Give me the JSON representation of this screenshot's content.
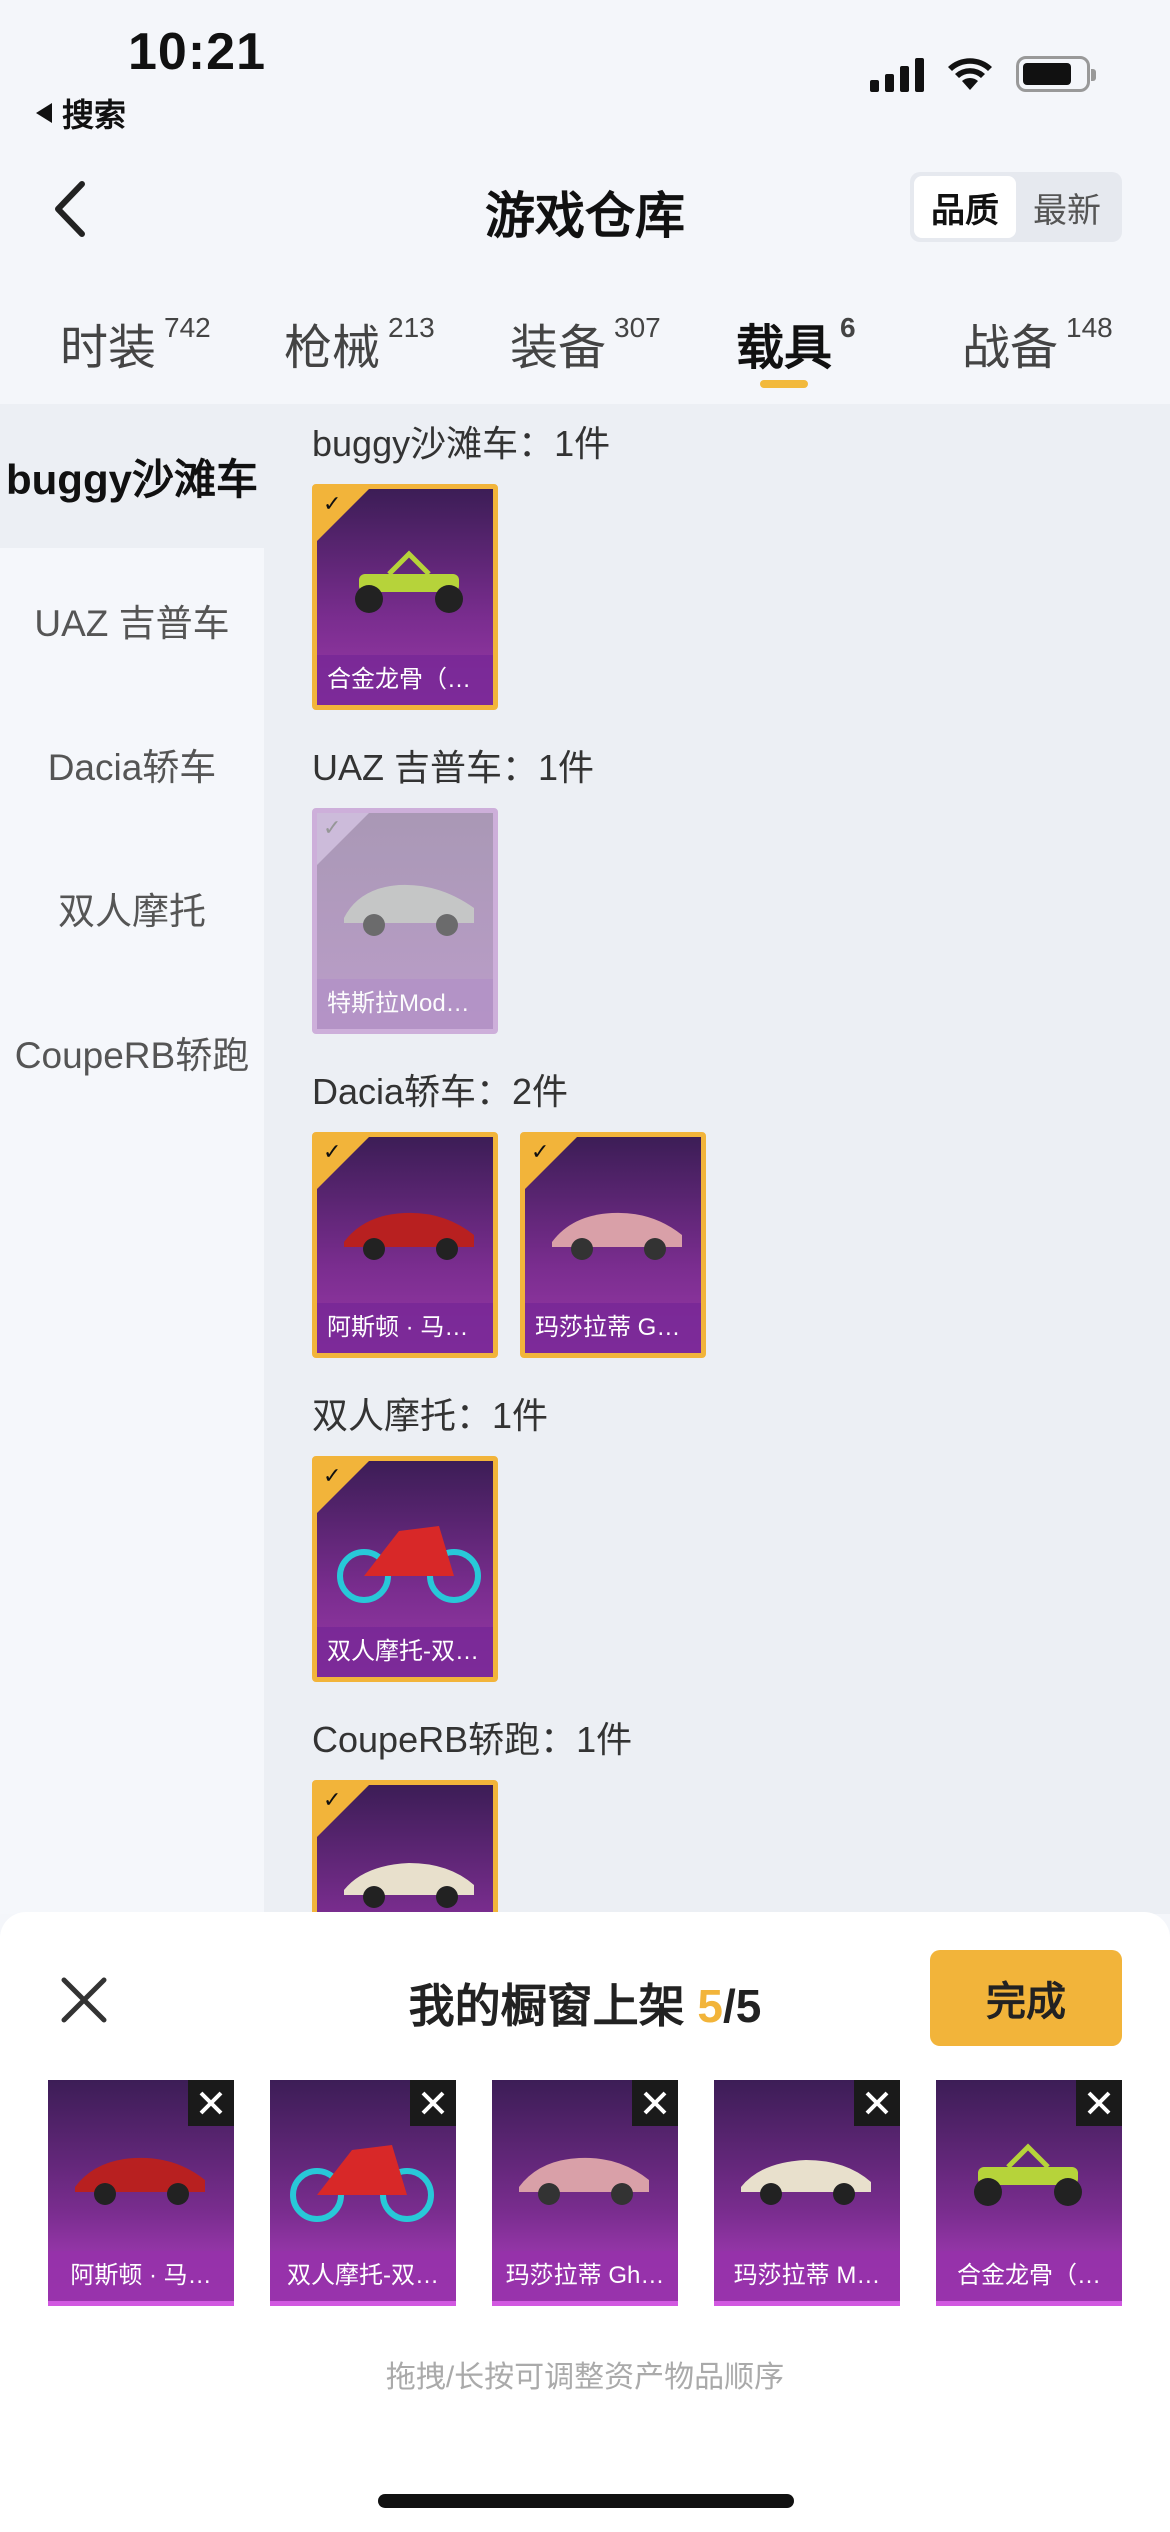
{
  "status_bar": {
    "time": "10:21",
    "back_app": "搜索"
  },
  "header": {
    "title": "游戏仓库",
    "sort_options": [
      "品质",
      "最新"
    ],
    "active_sort": "品质"
  },
  "tabs": [
    {
      "label": "时装",
      "count": "742"
    },
    {
      "label": "枪械",
      "count": "213"
    },
    {
      "label": "装备",
      "count": "307"
    },
    {
      "label": "载具",
      "count": "6"
    },
    {
      "label": "战备",
      "count": "148"
    }
  ],
  "active_tab": "载具",
  "sidebar": {
    "items": [
      {
        "label": "buggy沙滩车"
      },
      {
        "label": "UAZ 吉普车"
      },
      {
        "label": "Dacia轿车"
      },
      {
        "label": "双人摩托"
      },
      {
        "label": "CoupeRB轿跑"
      }
    ]
  },
  "groups": [
    {
      "title": "buggy沙滩车：1件",
      "items": [
        {
          "name": "合金龙骨（…",
          "selected": true,
          "color": "#b6d33a"
        }
      ]
    },
    {
      "title": "UAZ 吉普车：1件",
      "items": [
        {
          "name": "特斯拉Mod…",
          "selected": false,
          "color": "#bfbfbf"
        }
      ]
    },
    {
      "title": "Dacia轿车：2件",
      "items": [
        {
          "name": "阿斯顿 · 马…",
          "selected": true,
          "color": "#b82020"
        },
        {
          "name": "玛莎拉蒂 Gh…",
          "selected": true,
          "color": "#d9a0a8"
        }
      ]
    },
    {
      "title": "双人摩托：1件",
      "items": [
        {
          "name": "双人摩托-双…",
          "selected": true,
          "color": "#d82828"
        }
      ]
    },
    {
      "title": "CoupeRB轿跑：1件",
      "items": [
        {
          "name": "",
          "selected": true,
          "color": "#e8e0cc"
        }
      ]
    }
  ],
  "sheet": {
    "title_prefix": "我的橱窗上架",
    "count_current": "5",
    "count_total": "/5",
    "done_label": "完成",
    "items": [
      {
        "name": "阿斯顿 · 马…",
        "color": "#b82020"
      },
      {
        "name": "双人摩托-双…",
        "color": "#d82828"
      },
      {
        "name": "玛莎拉蒂 Gh…",
        "color": "#d9a0a8"
      },
      {
        "name": "玛莎拉蒂 M…",
        "color": "#e8e0cc"
      },
      {
        "name": "合金龙骨（…",
        "color": "#b6d33a"
      }
    ],
    "hint": "拖拽/长按可调整资产物品顺序"
  }
}
